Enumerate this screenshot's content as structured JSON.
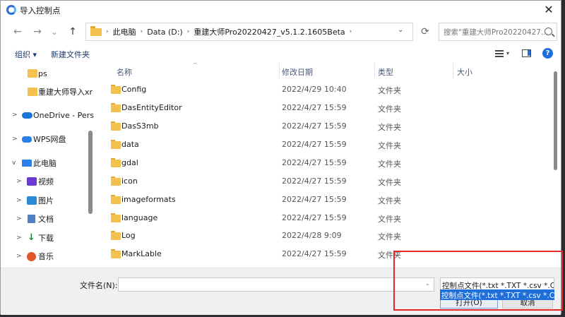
{
  "window": {
    "title": "导入控制点",
    "close_glyph": "✕"
  },
  "nav": {
    "back_glyph": "←",
    "forward_glyph": "→",
    "recent_glyph": "⌄",
    "up_glyph": "↑",
    "breadcrumb": [
      "此电脑",
      "Data (D:)",
      "重建大师Pro20220427_v5.1.2.1605Beta"
    ],
    "refresh_glyph": "⟳",
    "search_placeholder": "搜索\"重建大师Pro20220427...",
    "dropdown_glyph": "⌄",
    "crumb_sep": "›"
  },
  "toolbar": {
    "organize": "组织 ▾",
    "new_folder": "新建文件夹",
    "view_drop": "▾",
    "help": "?"
  },
  "sidebar": {
    "items": [
      {
        "label": "ps",
        "icon": "folder-icon",
        "chevron": ""
      },
      {
        "label": "重建大师导入xr",
        "icon": "folder-icon",
        "chevron": ""
      },
      {
        "label": "OneDrive - Pers",
        "icon": "cloud-icon",
        "chevron": ">"
      },
      {
        "label": "WPS网盘",
        "icon": "wps-icon",
        "chevron": ">"
      },
      {
        "label": "此电脑",
        "icon": "pc-icon",
        "chevron": "v"
      },
      {
        "label": "视频",
        "icon": "video-icon",
        "chevron": ">"
      },
      {
        "label": "图片",
        "icon": "picture-icon",
        "chevron": ">"
      },
      {
        "label": "文档",
        "icon": "document-icon",
        "chevron": ">"
      },
      {
        "label": "下载",
        "icon": "download-icon",
        "chevron": ">"
      },
      {
        "label": "音乐",
        "icon": "music-icon",
        "chevron": ">"
      }
    ],
    "download_glyph": "↓"
  },
  "columns": {
    "name": "名称",
    "date": "修改日期",
    "type": "类型",
    "size": "大小",
    "sort_glyph": "^"
  },
  "files": [
    {
      "name": "Config",
      "date": "2022/4/29 10:40",
      "type": "文件夹"
    },
    {
      "name": "DasEntityEditor",
      "date": "2022/4/27 15:59",
      "type": "文件夹"
    },
    {
      "name": "DasS3mb",
      "date": "2022/4/27 15:59",
      "type": "文件夹"
    },
    {
      "name": "data",
      "date": "2022/4/27 15:59",
      "type": "文件夹"
    },
    {
      "name": "gdal",
      "date": "2022/4/27 15:59",
      "type": "文件夹"
    },
    {
      "name": "icon",
      "date": "2022/4/27 15:59",
      "type": "文件夹"
    },
    {
      "name": "imageformats",
      "date": "2022/4/27 15:59",
      "type": "文件夹"
    },
    {
      "name": "language",
      "date": "2022/4/27 15:59",
      "type": "文件夹"
    },
    {
      "name": "Log",
      "date": "2022/4/28 9:09",
      "type": "文件夹"
    },
    {
      "name": "MarkLable",
      "date": "2022/4/27 15:59",
      "type": "文件夹"
    }
  ],
  "bottom": {
    "filename_label": "文件名(N):",
    "filename_value": "",
    "filter_value": "控制点文件(*.txt *.TXT *.csv *.CSV)",
    "filter_option": "控制点文件(*.txt *.TXT *.csv *.CSV)",
    "open_label": "打开(O)",
    "cancel_label": "取消",
    "drop_glyph": "⌄"
  },
  "colors": {
    "accent": "#1e6fd9",
    "highlight": "#e02a2a",
    "folder": "#f2c14e"
  }
}
